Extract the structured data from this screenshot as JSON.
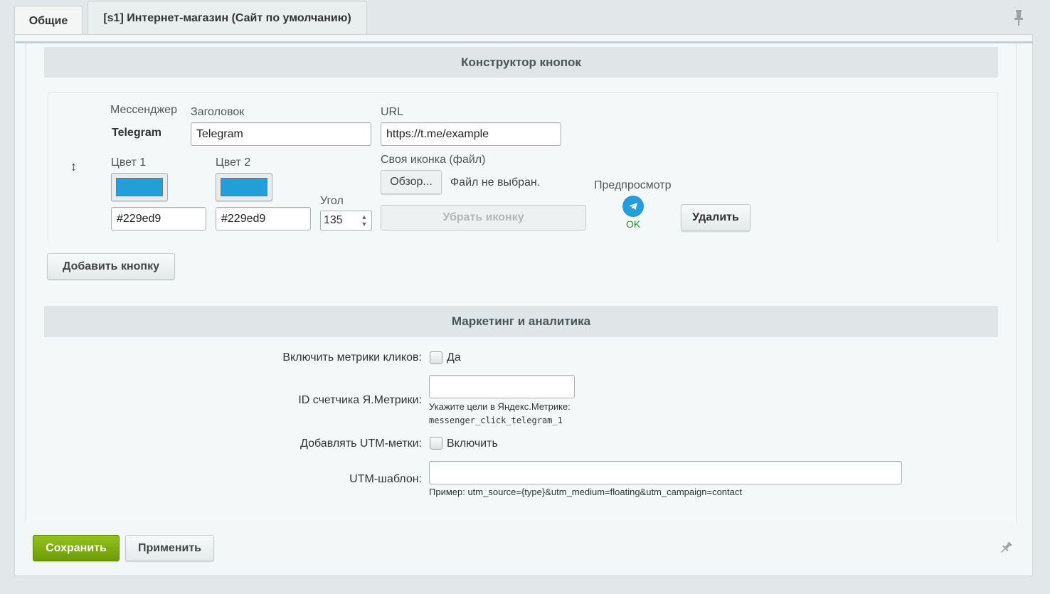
{
  "tabs": [
    {
      "label": "Общие"
    },
    {
      "label": "[s1] Интернет-магазин (Сайт по умолчанию)"
    }
  ],
  "sections": {
    "constructor_title": "Конструктор кнопок",
    "marketing_title": "Маркетинг и аналитика"
  },
  "button_row": {
    "messenger_label": "Мессенджер",
    "messenger_value": "Telegram",
    "title_label": "Заголовок",
    "title_value": "Telegram",
    "url_label": "URL",
    "url_value": "https://t.me/example",
    "color1_label": "Цвет 1",
    "color1_value": "#229ed9",
    "color2_label": "Цвет 2",
    "color2_value": "#229ed9",
    "angle_label": "Угол",
    "angle_value": "135",
    "custom_icon_label": "Своя иконка (файл)",
    "browse_label": "Обзор...",
    "no_file_label": "Файл не выбран.",
    "remove_icon_label": "Убрать иконку",
    "preview_label": "Предпросмотр",
    "preview_status": "OK",
    "delete_label": "Удалить",
    "drag_glyph": "↕"
  },
  "add_button_label": "Добавить кнопку",
  "marketing": {
    "click_metrics_label": "Включить метрики кликов:",
    "click_metrics_checkbox": "Да",
    "ym_counter_label": "ID счетчика Я.Метрики:",
    "ym_counter_value": "",
    "ym_hint": "Укажите цели в Яндекс.Метрике:",
    "ym_goal": "messenger_click_telegram_1",
    "utm_label": "Добавлять UTM-метки:",
    "utm_checkbox": "Включить",
    "utm_template_label": "UTM-шаблон:",
    "utm_template_value": "",
    "utm_hint": "Пример: utm_source={type}&utm_medium=floating&utm_campaign=contact"
  },
  "footer": {
    "save_label": "Сохранить",
    "apply_label": "Применить"
  },
  "colors": {
    "telegram_blue": "#229ed9",
    "save_green": "#7aaa10"
  },
  "icons": {
    "pin": "pin-icon",
    "preview": "telegram-icon"
  }
}
